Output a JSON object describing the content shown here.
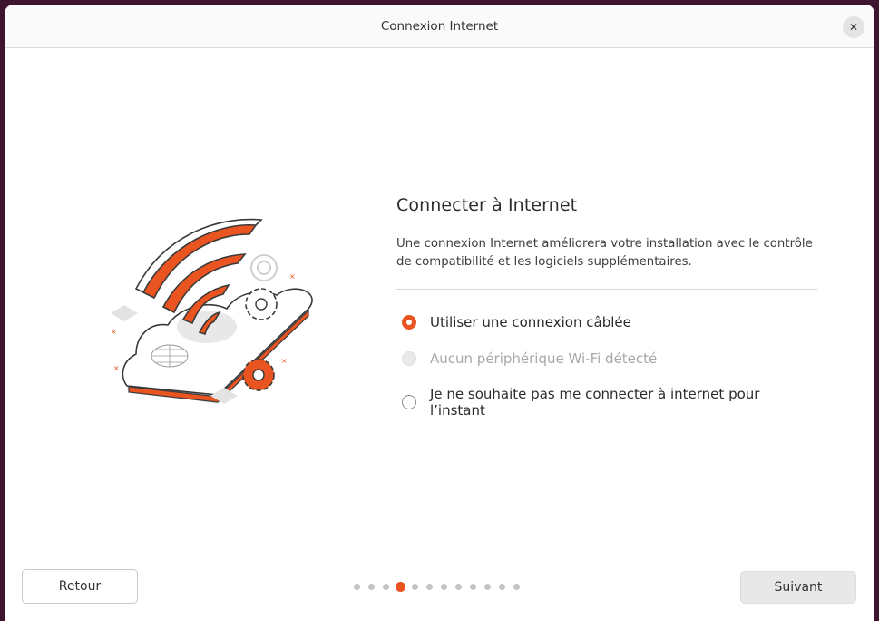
{
  "window": {
    "title": "Connexion Internet",
    "close_icon": "close-icon"
  },
  "main": {
    "heading": "Connecter à Internet",
    "description": "Une connexion Internet améliorera votre installation avec le contrôle de compatibilité et les logiciels supplémentaires.",
    "options": [
      {
        "label": "Utiliser une connexion câblée",
        "state": "selected"
      },
      {
        "label": "Aucun périphérique Wi-Fi détecté",
        "state": "disabled"
      },
      {
        "label": "Je ne souhaite pas me connecter à internet pour l’instant",
        "state": "unselected"
      }
    ]
  },
  "footer": {
    "back_label": "Retour",
    "next_label": "Suivant",
    "progress": {
      "total_steps": 12,
      "current_step": 4
    }
  },
  "colors": {
    "accent": "#E95420",
    "illustration_dark": "#3A3A3A",
    "desktop_bg": "#3D1530"
  },
  "illustration": {
    "name": "network-illustration",
    "icons": [
      "wifi-icon",
      "cloud-icon",
      "gear-icon",
      "globe-icon"
    ]
  }
}
